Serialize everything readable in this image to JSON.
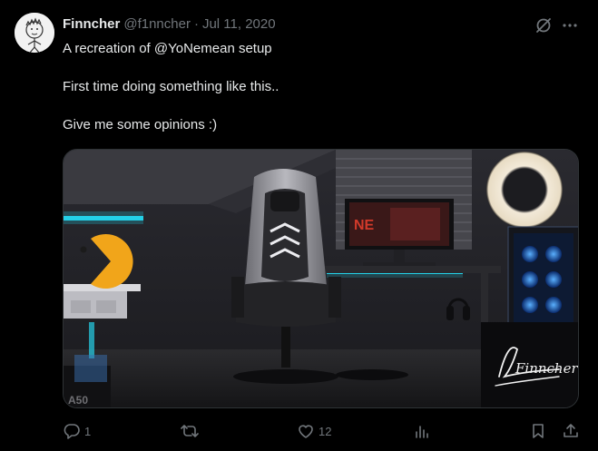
{
  "tweet": {
    "display_name": "Finncher",
    "handle": "@f1nncher",
    "separator": "·",
    "date": "Jul 11, 2020",
    "text_lines": [
      "A recreation of @YoNemean setup",
      "First time doing something like this..",
      "Give me some opinions :)"
    ],
    "media": {
      "signature_text": "Finncher",
      "psu_label": "A50"
    }
  },
  "actions": {
    "reply_count": "1",
    "retweet_count": "",
    "like_count": "12",
    "views_count": ""
  },
  "colors": {
    "background": "#000000",
    "text_primary": "#e7e9ea",
    "text_secondary": "#71767b",
    "accent_glow": "#25d0e8"
  },
  "icons": [
    "grok-icon",
    "more-icon",
    "reply-icon",
    "retweet-icon",
    "like-icon",
    "views-icon",
    "bookmark-icon",
    "share-icon"
  ]
}
